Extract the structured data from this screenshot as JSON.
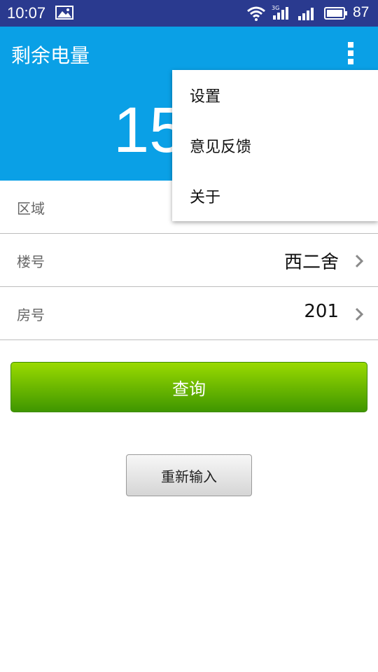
{
  "status_bar": {
    "time": "10:07",
    "network": "3G",
    "battery_level": "87"
  },
  "app_bar": {
    "title": "剩余电量",
    "remaining_value_partial": "15",
    "more_icon": "overflow-menu-icon"
  },
  "form": {
    "area": {
      "label": "区域",
      "value": ""
    },
    "building": {
      "label": "楼号",
      "value": "西二舍"
    },
    "room": {
      "label": "房号",
      "value": "201"
    }
  },
  "buttons": {
    "query": "查询",
    "reset": "重新输入"
  },
  "overflow_menu": {
    "items": [
      {
        "label": "设置"
      },
      {
        "label": "意见反馈"
      },
      {
        "label": "关于"
      }
    ]
  },
  "colors": {
    "status_bar": "#2a3a8f",
    "app_bar": "#0aa0e6",
    "query_button_top": "#9ada00",
    "query_button_bottom": "#3f9600"
  }
}
